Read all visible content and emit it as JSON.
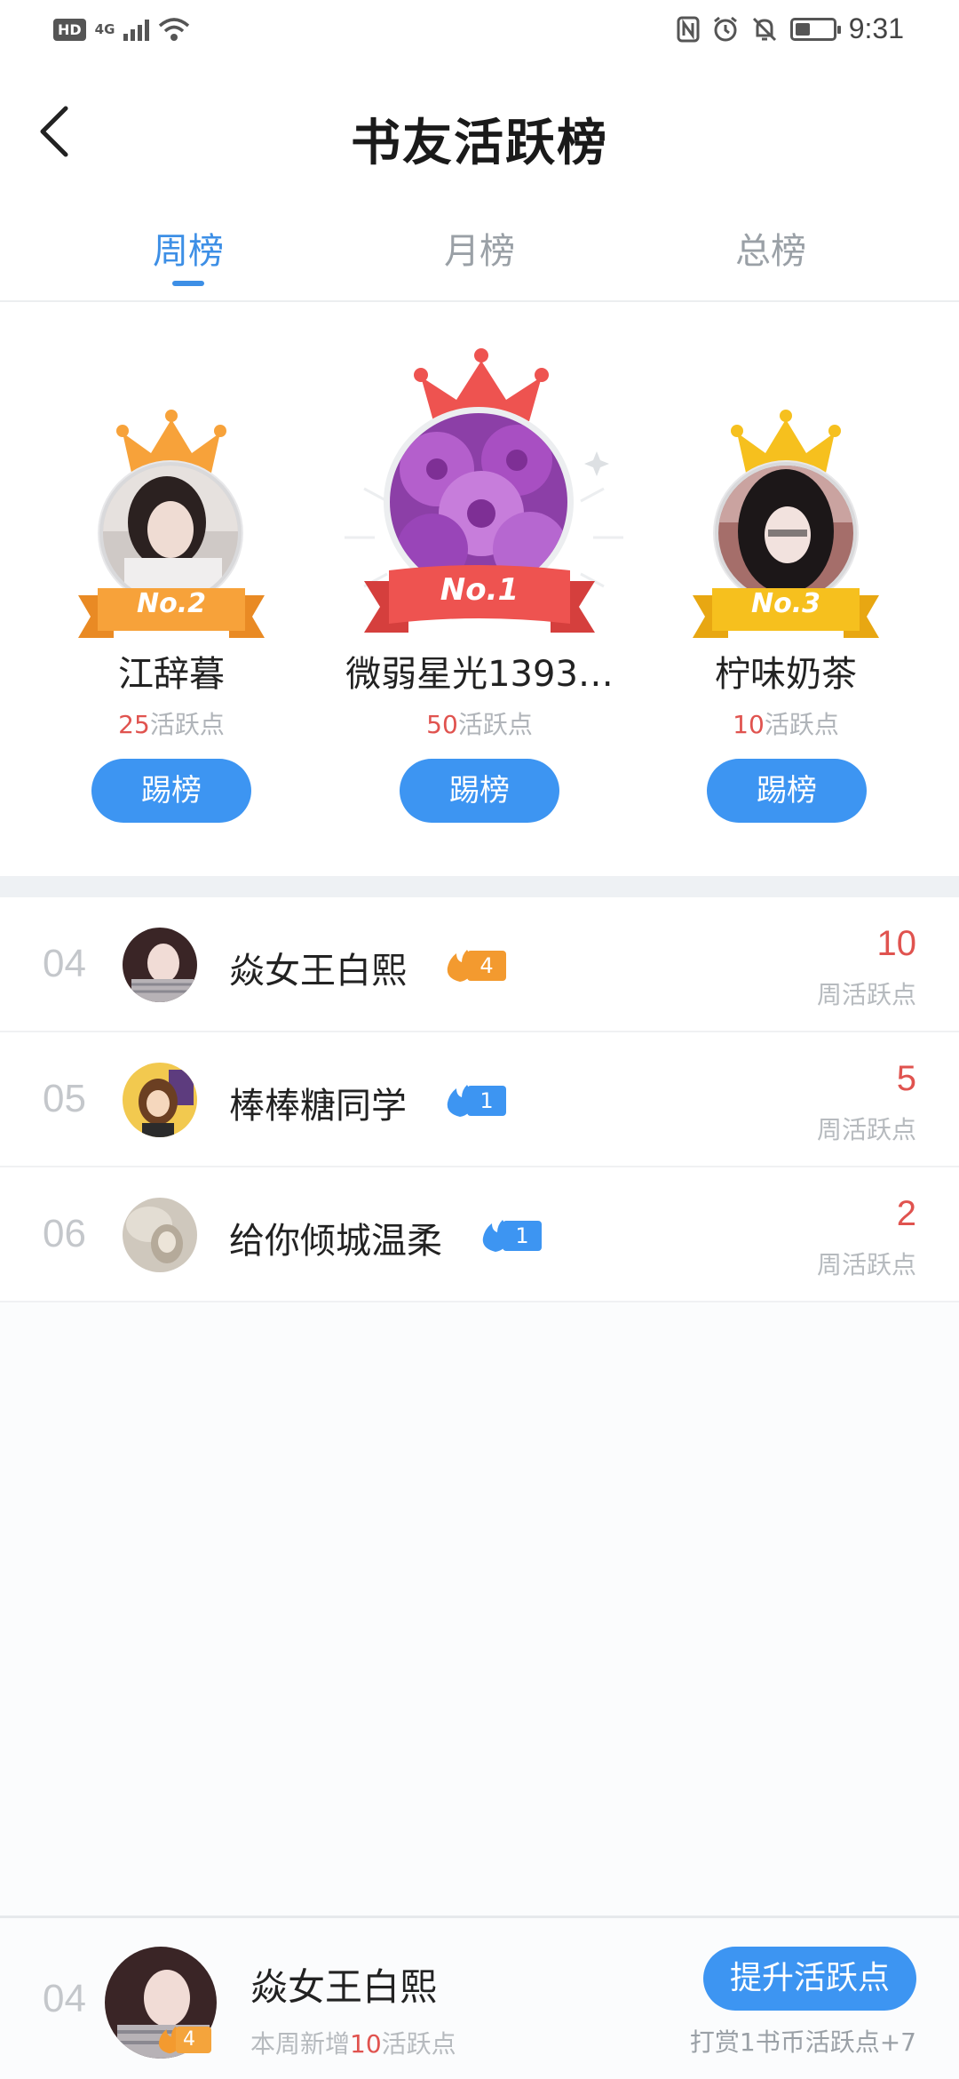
{
  "status_bar": {
    "hd": "HD",
    "network": "4G",
    "time": "9:31",
    "battery_level": 0.4
  },
  "header": {
    "title": "书友活跃榜",
    "back_icon": "chevron-left-icon"
  },
  "tabs": [
    {
      "label": "周榜",
      "active": true
    },
    {
      "label": "月榜",
      "active": false
    },
    {
      "label": "总榜",
      "active": false
    }
  ],
  "podium": {
    "first": {
      "rank_label": "No.1",
      "name": "微弱星光1393…",
      "points": "50",
      "points_suffix": "活跃点",
      "button": "踢榜"
    },
    "second": {
      "rank_label": "No.2",
      "name": "江辞暮",
      "points": "25",
      "points_suffix": "活跃点",
      "button": "踢榜"
    },
    "third": {
      "rank_label": "No.3",
      "name": "柠味奶茶",
      "points": "10",
      "points_suffix": "活跃点",
      "button": "踢榜"
    }
  },
  "list": [
    {
      "rank": "04",
      "name": "焱女王白熙",
      "level": "4",
      "level_color": "#f39a2f",
      "score": "10",
      "score_label": "周活跃点"
    },
    {
      "rank": "05",
      "name": "棒棒糖同学",
      "level": "1",
      "level_color": "#3d95f2",
      "score": "5",
      "score_label": "周活跃点"
    },
    {
      "rank": "06",
      "name": "给你倾城温柔",
      "level": "1",
      "level_color": "#3d95f2",
      "score": "2",
      "score_label": "周活跃点"
    }
  ],
  "me": {
    "rank": "04",
    "name": "焱女王白熙",
    "level": "4",
    "sub_prefix": "本周新增",
    "sub_num": "10",
    "sub_suffix": "活跃点",
    "button": "提升活跃点",
    "hint": "打赏1书币活跃点+7"
  },
  "colors": {
    "accent": "#3d95f2",
    "points": "#e0534f"
  }
}
